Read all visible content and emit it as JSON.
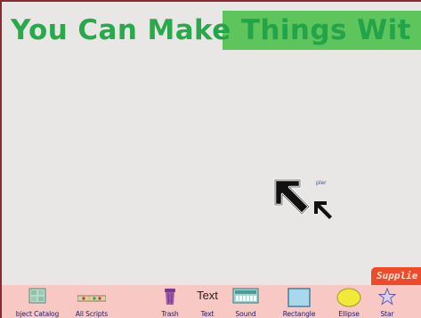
{
  "world": {
    "title_part1": "You Can Mak",
    "title_part2": "e Things Wit",
    "pointer_label": "pler"
  },
  "supplies": {
    "tab_label": "Supplie"
  },
  "flap_items": [
    {
      "label": "bject Catalog",
      "icon": "object-catalog-icon"
    },
    {
      "label": "All Scripts",
      "icon": "all-scripts-icon"
    },
    {
      "label": "Trash",
      "icon": "trash-icon"
    },
    {
      "label": "Text",
      "icon": "text-icon",
      "glyph": "Text"
    },
    {
      "label": "Sound",
      "icon": "sound-icon"
    },
    {
      "label": "Rectangle",
      "icon": "rectangle-icon"
    },
    {
      "label": "Ellipse",
      "icon": "ellipse-icon"
    },
    {
      "label": "Star",
      "icon": "star-icon"
    }
  ],
  "colors": {
    "title_text": "#29a94c",
    "title_highlight": "#5ec45c",
    "supplies_tab": "#ef4a2a",
    "flap_bg": "#f7c8c4",
    "world_bg": "#e9e7e5"
  }
}
